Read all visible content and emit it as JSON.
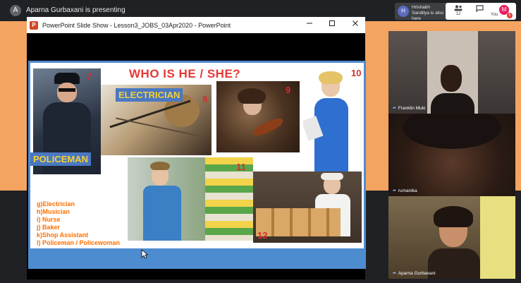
{
  "top_bar": {
    "presenter_initial": "A",
    "presenter_text": "Aparna Gurbaxani is presenting"
  },
  "hrishabh_notice": {
    "initial": "H",
    "text": "Hrishabh Sandilya is also here"
  },
  "controls": {
    "people_count": "12",
    "you_label": "You",
    "you_initial": "M",
    "badge": "6"
  },
  "ppt_window": {
    "title": "PowerPoint Slide Show  -  Lesson3_JOBS_03Apr2020 - PowerPoint",
    "logo": "P"
  },
  "slide": {
    "title": "WHO IS HE / SHE?",
    "tags": {
      "electrician": "ELECTRICIAN",
      "policeman": "POLICEMAN"
    },
    "numbers": [
      "7",
      "8",
      "9",
      "10",
      "11",
      "12"
    ],
    "word_list": [
      "g)Electrician",
      "h)Musician",
      "i) Nurse",
      "j) Baker",
      "k)Shop Assistant",
      "l) Policeman / Policewoman"
    ]
  },
  "participants": [
    {
      "name": "Franklin Muki"
    },
    {
      "name": "rumanika"
    },
    {
      "name": "Aparna Gurbaxani"
    }
  ],
  "colors": {
    "accent_orange": "#f4a460",
    "slide_border": "#4d8ccf",
    "title_red": "#e53935",
    "list_orange": "#ff6f00",
    "tag_yellow": "#f7d034"
  }
}
